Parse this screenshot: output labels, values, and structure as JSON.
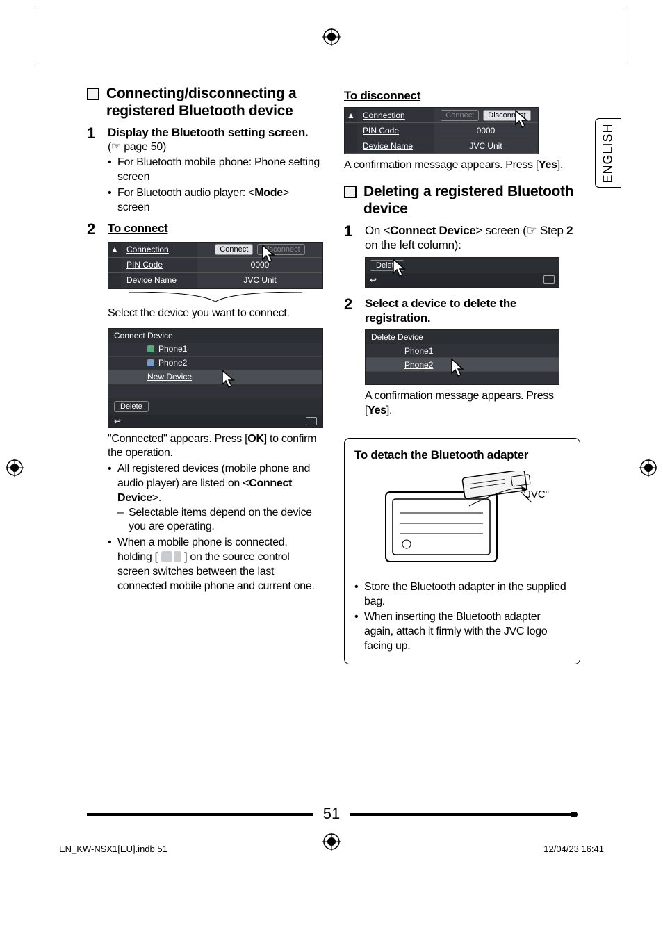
{
  "page_number": "51",
  "language_tab": "ENGLISH",
  "footer_left": "EN_KW-NSX1[EU].indb   51",
  "footer_right": "12/04/23   16:41",
  "left": {
    "section_title": "Connecting/disconnecting a registered Bluetooth device",
    "step1_num": "1",
    "step1_title": "Display the Bluetooth setting screen.",
    "step1_ref": "(☞ page 50)",
    "step1_b1": "For Bluetooth mobile phone: Phone setting screen",
    "step1_b2_pre": "For Bluetooth audio player: <",
    "step1_b2_bold": "Mode",
    "step1_b2_post": "> screen",
    "step2_num": "2",
    "step2_title": "To connect",
    "ui1": {
      "r1_label": "Connection",
      "r1_btn1": "Connect",
      "r1_btn2": "Disconnect",
      "r2_label": "PIN Code",
      "r2_val": "0000",
      "r3_label": "Device Name",
      "r3_val": "JVC Unit"
    },
    "select_line": "Select the device you want to connect.",
    "ui2": {
      "title": "Connect Device",
      "i1": "Phone1",
      "i2": "Phone2",
      "i3": "New Device",
      "del": "Delete"
    },
    "connected_pre": "\"Connected\" appears. Press [",
    "connected_bold": "OK",
    "connected_post": "] to confirm the operation.",
    "b1_pre": "All registered devices (mobile phone and audio player) are listed on <",
    "b1_bold": "Connect Device",
    "b1_post": ">.",
    "b1_sub": "Selectable items depend on the device you are operating.",
    "b2_pre": "When a mobile phone is connected, holding [",
    "b2_post": "] on the source control screen switches between the last connected mobile phone and current one."
  },
  "right": {
    "disc_title": "To disconnect",
    "ui3": {
      "r1_label": "Connection",
      "r1_btn1": "Connect",
      "r1_btn2": "Disconnect",
      "r2_label": "PIN Code",
      "r2_val": "0000",
      "r3_label": "Device Name",
      "r3_val": "JVC Unit"
    },
    "disc_confirm_pre": "A confirmation message appears. Press [",
    "disc_confirm_bold": "Yes",
    "disc_confirm_post": "].",
    "section_title": "Deleting a registered Bluetooth device",
    "step1_num": "1",
    "step1_pre": "On <",
    "step1_bold1": "Connect Device",
    "step1_mid": "> screen (☞ Step ",
    "step1_bold2": "2",
    "step1_post": " on the left column):",
    "ui4_del": "Delete",
    "step2_num": "2",
    "step2_title": "Select a device to delete the registration.",
    "ui5": {
      "title": "Delete Device",
      "i1": "Phone1",
      "i2": "Phone2"
    },
    "del_confirm_pre": "A confirmation message appears. Press [",
    "del_confirm_bold": "Yes",
    "del_confirm_post": "].",
    "detach_title": "To detach the Bluetooth adapter",
    "detach_label": "\"JVC\"",
    "detach_b1": "Store the Bluetooth adapter in the supplied bag.",
    "detach_b2": "When inserting the Bluetooth adapter again, attach it firmly with the JVC logo facing up."
  }
}
